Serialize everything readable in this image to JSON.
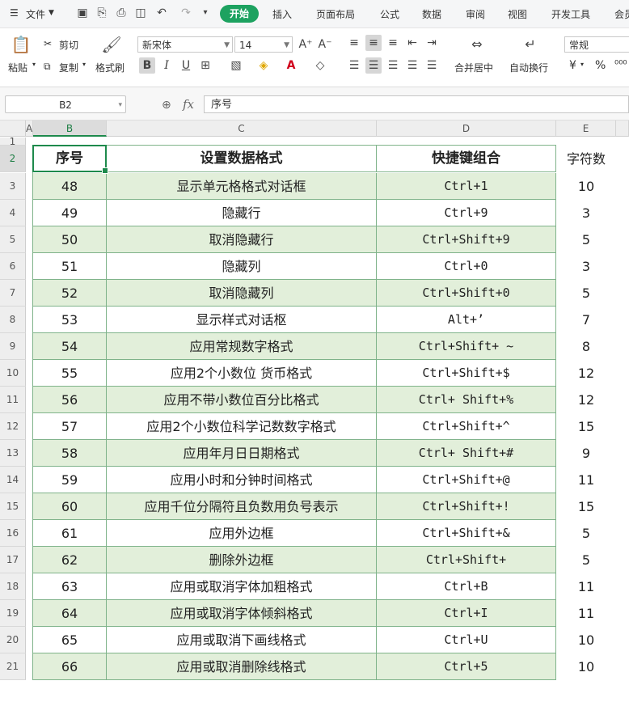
{
  "menubar": {
    "file_label": "文件",
    "tabs": [
      "开始",
      "插入",
      "页面布局",
      "公式",
      "数据",
      "审阅",
      "视图",
      "开发工具",
      "会员"
    ]
  },
  "ribbon": {
    "paste": "粘贴",
    "cut": "剪切",
    "copy": "复制",
    "format_painter": "格式刷",
    "font_name": "新宋体",
    "font_size": "14",
    "merge_center": "合并居中",
    "wrap_text": "自动换行",
    "number_format": "常规",
    "currency": "¥",
    "percent": "%"
  },
  "formula_bar": {
    "name_box": "B2",
    "fx": "fx",
    "content": "序号"
  },
  "columns": [
    "A",
    "B",
    "C",
    "D",
    "E"
  ],
  "rows": [
    "1",
    "2",
    "3",
    "4",
    "5",
    "6",
    "7",
    "8",
    "9",
    "10",
    "11",
    "12",
    "13",
    "14",
    "15",
    "16",
    "17",
    "18",
    "19",
    "20",
    "21"
  ],
  "table": {
    "headers": [
      "序号",
      "设置数据格式",
      "快捷键组合",
      "字符数"
    ],
    "rows": [
      [
        "48",
        "显示单元格格式对话框",
        "Ctrl+1",
        "10"
      ],
      [
        "49",
        "隐藏行",
        "Ctrl+9",
        "3"
      ],
      [
        "50",
        "取消隐藏行",
        "Ctrl+Shift+9",
        "5"
      ],
      [
        "51",
        "隐藏列",
        "Ctrl+0",
        "3"
      ],
      [
        "52",
        "取消隐藏列",
        "Ctrl+Shift+0",
        "5"
      ],
      [
        "53",
        "显示样式对话枢",
        "Alt+’",
        "7"
      ],
      [
        "54",
        "应用常规数字格式",
        "Ctrl+Shift+ ~",
        "8"
      ],
      [
        "55",
        "应用2个小数位 货币格式",
        "Ctrl+Shift+$",
        "12"
      ],
      [
        "56",
        "应用不带小数位百分比格式",
        "Ctrl+ Shift+%",
        "12"
      ],
      [
        "57",
        "应用2个小数位科学记数数字格式",
        "Ctrl+Shift+^",
        "15"
      ],
      [
        "58",
        "应用年月日日期格式",
        "Ctrl+ Shift+#",
        "9"
      ],
      [
        "59",
        "应用小时和分钟时间格式",
        "Ctrl+Shift+@",
        "11"
      ],
      [
        "60",
        "应用千位分隔符且负数用负号表示",
        "Ctrl+Shift+!",
        "15"
      ],
      [
        "61",
        "应用外边框",
        "Ctrl+Shift+&",
        "5"
      ],
      [
        "62",
        "删除外边框",
        "Ctrl+Shift+",
        "5"
      ],
      [
        "63",
        "应用或取消字体加粗格式",
        "Ctrl+B",
        "11"
      ],
      [
        "64",
        "应用或取消字体倾斜格式",
        "Ctrl+I",
        "11"
      ],
      [
        "65",
        "应用或取消下画线格式",
        "Ctrl+U",
        "10"
      ],
      [
        "66",
        "应用或取消删除线格式",
        "Ctrl+5",
        "10"
      ]
    ]
  },
  "colors": {
    "accent": "#1da260",
    "green_row": "#e2efda",
    "border": "#7fb38a"
  }
}
